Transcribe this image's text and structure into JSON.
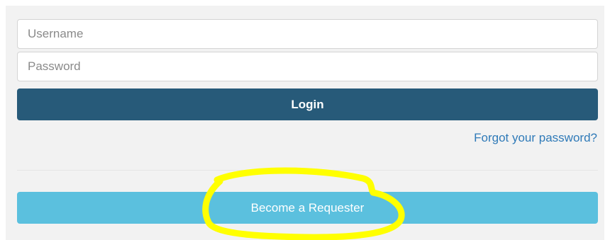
{
  "login_form": {
    "username_placeholder": "Username",
    "password_placeholder": "Password",
    "login_label": "Login",
    "forgot_password_label": "Forgot your password?",
    "become_requester_label": "Become a Requester"
  },
  "colors": {
    "panel_background": "#f2f2f2",
    "login_button": "#275a79",
    "requester_button": "#5bc0de",
    "link": "#2f7ab8",
    "highlight_annotation": "#ffff00"
  }
}
